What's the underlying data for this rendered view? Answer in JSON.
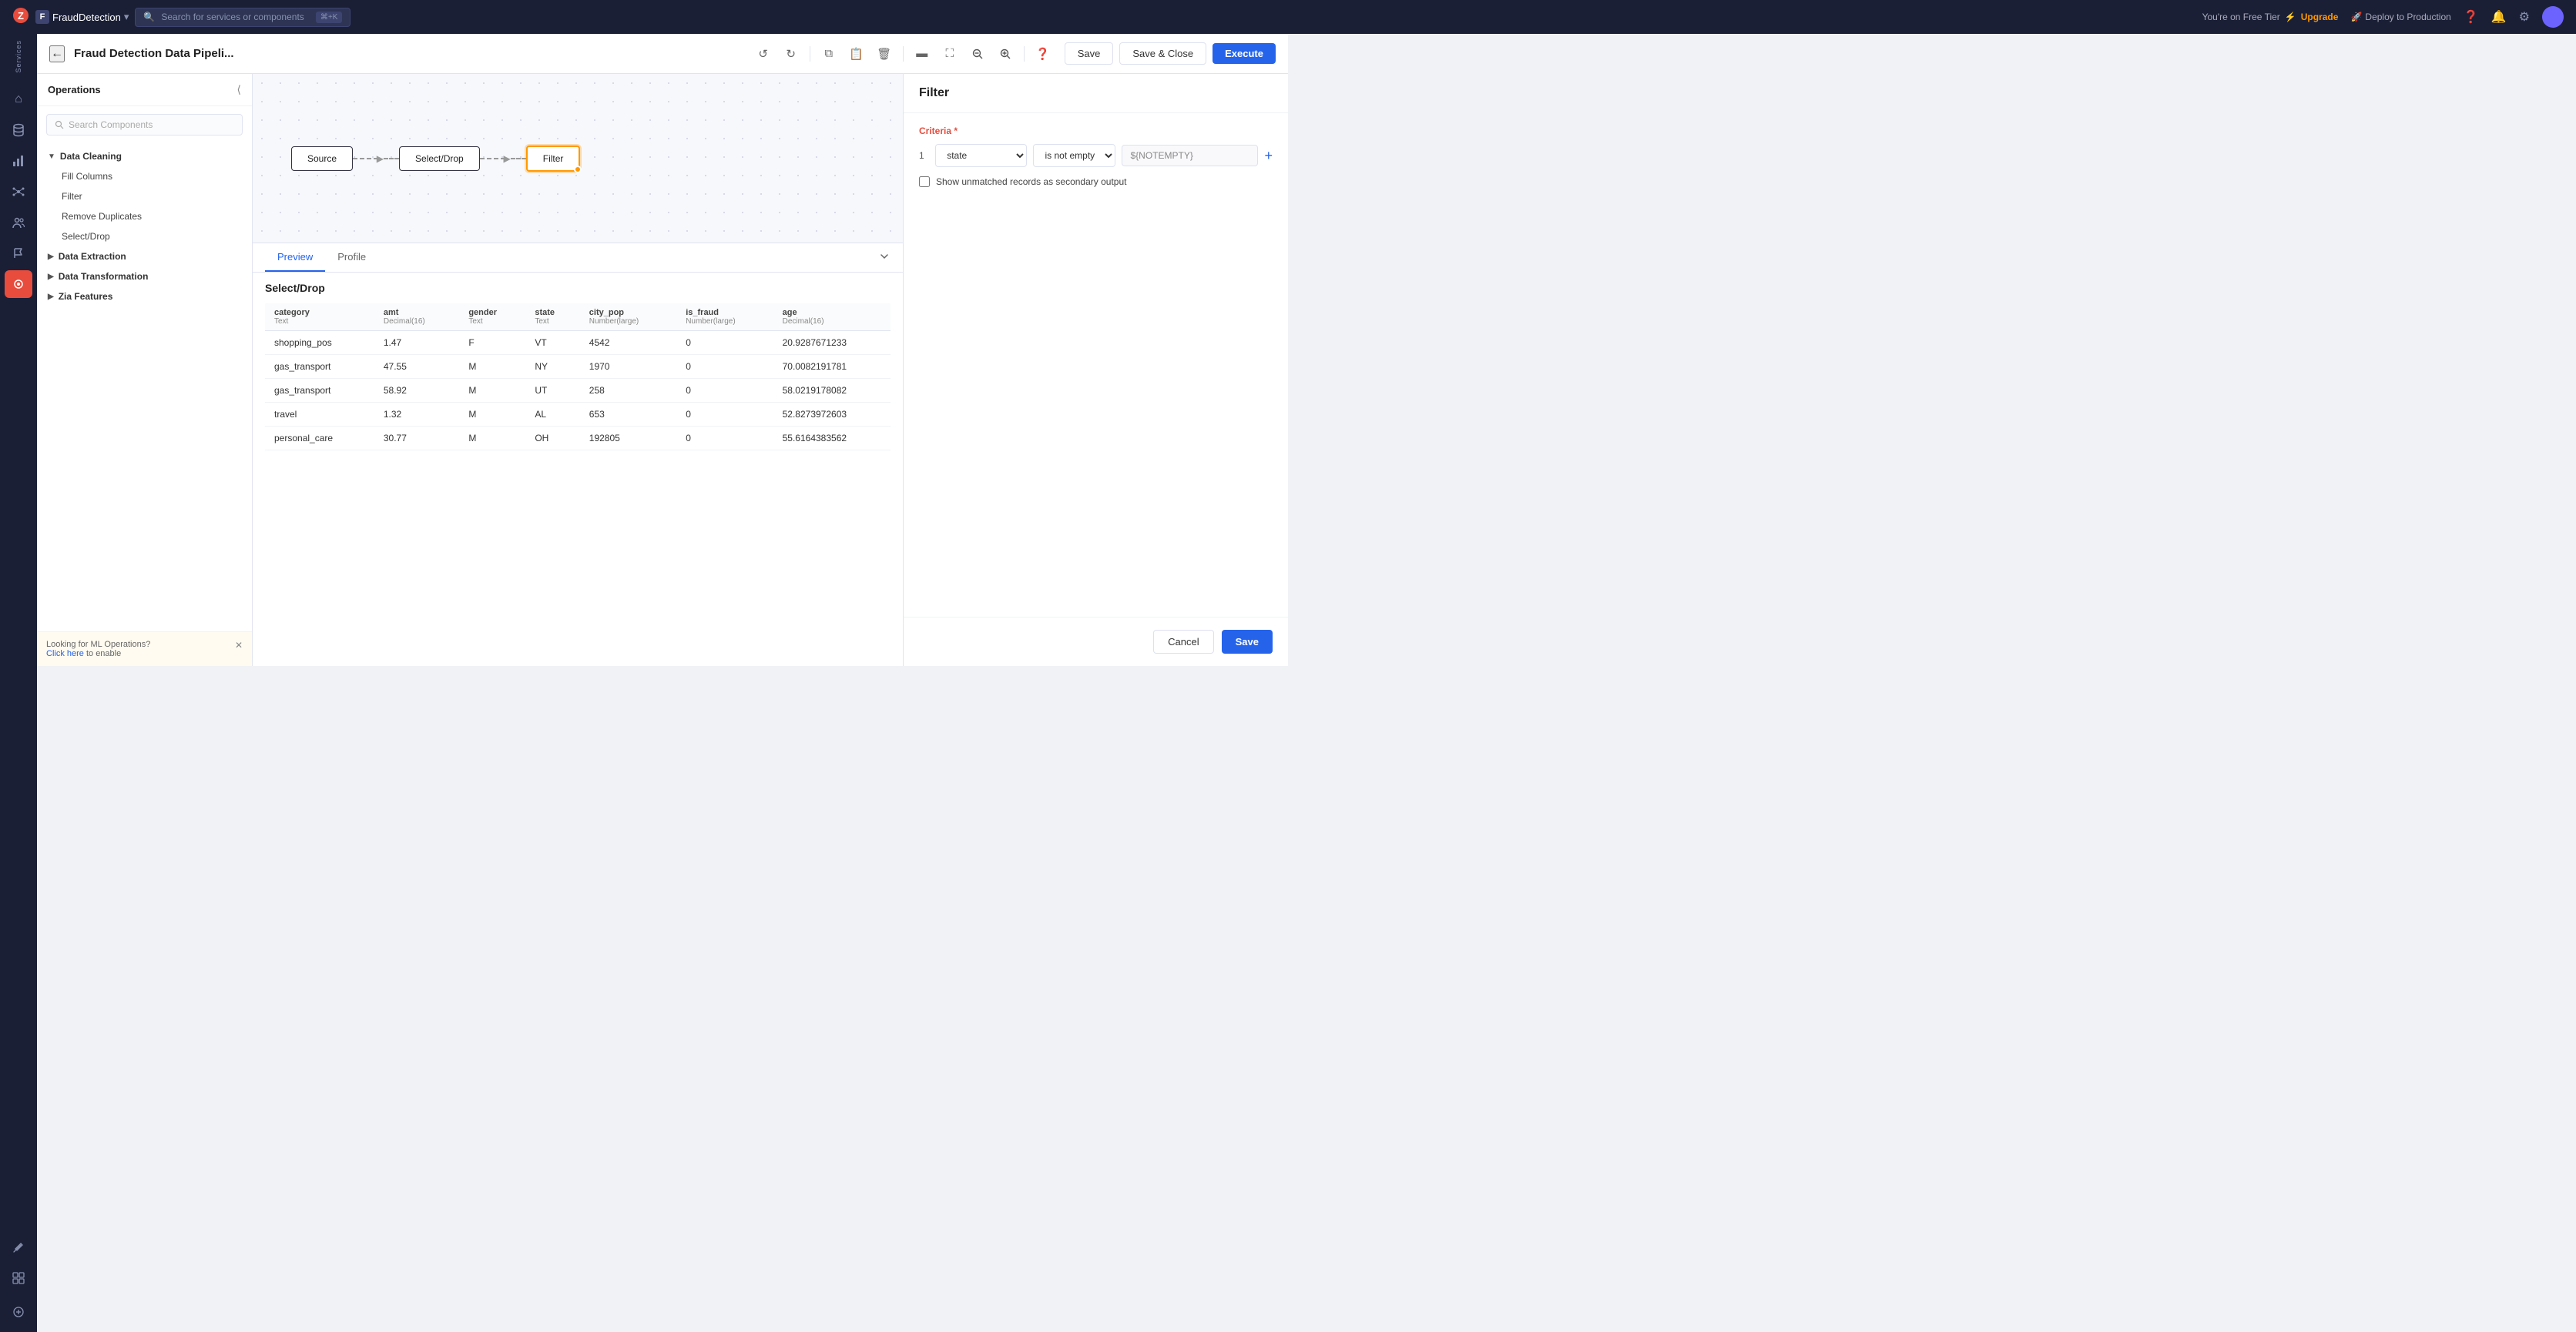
{
  "topNav": {
    "logo": "Z",
    "projectName": "FraudDetection",
    "searchPlaceholder": "Search for services or components",
    "searchShortcut": "⌘+K",
    "tierText": "You're on Free Tier",
    "upgradeLabel": "Upgrade",
    "deployLabel": "Deploy to Production"
  },
  "sidebar": {
    "servicesLabel": "Services",
    "items": [
      {
        "name": "home-icon",
        "icon": "⌂",
        "active": false
      },
      {
        "name": "database-icon",
        "icon": "🗄",
        "active": false
      },
      {
        "name": "chart-icon",
        "icon": "📊",
        "active": false
      },
      {
        "name": "network-icon",
        "icon": "⛙",
        "active": false
      },
      {
        "name": "people-icon",
        "icon": "👥",
        "active": false
      },
      {
        "name": "flag-icon",
        "icon": "⚑",
        "active": false
      },
      {
        "name": "pipeline-icon",
        "icon": "◎",
        "active": true
      },
      {
        "name": "settings-icon",
        "icon": "⚙",
        "active": false
      },
      {
        "name": "brush-icon",
        "icon": "✏",
        "active": false
      },
      {
        "name": "puzzle-icon",
        "icon": "⊞",
        "active": false
      }
    ]
  },
  "pipelineHeader": {
    "title": "Fraud Detection Data Pipeli...",
    "saveLabel": "Save",
    "saveCloseLabel": "Save & Close",
    "executeLabel": "Execute"
  },
  "operations": {
    "title": "Operations",
    "searchPlaceholder": "Search Components",
    "categories": [
      {
        "name": "Data Cleaning",
        "expanded": true,
        "items": [
          "Fill Columns",
          "Filter",
          "Remove Duplicates",
          "Select/Drop"
        ]
      },
      {
        "name": "Data Extraction",
        "expanded": false,
        "items": []
      },
      {
        "name": "Data Transformation",
        "expanded": false,
        "items": []
      },
      {
        "name": "Zia Features",
        "expanded": false,
        "items": []
      }
    ],
    "footer": {
      "text": "Looking for ML Operations?",
      "linkText": "Click here",
      "linkSuffix": " to enable"
    }
  },
  "pipeline": {
    "nodes": [
      {
        "label": "Source",
        "active": false
      },
      {
        "label": "Select/Drop",
        "active": false
      },
      {
        "label": "Filter",
        "active": true
      }
    ]
  },
  "filter": {
    "title": "Filter",
    "criteriaLabel": "Criteria",
    "required": true,
    "row": {
      "number": "1",
      "field": "state",
      "condition": "is not empty",
      "value": "${NOTEMPTY}"
    },
    "checkboxLabel": "Show unmatched records as secondary output",
    "cancelLabel": "Cancel",
    "saveLabel": "Save"
  },
  "preview": {
    "tabs": [
      {
        "label": "Preview",
        "active": true
      },
      {
        "label": "Profile",
        "active": false
      }
    ],
    "title": "Select/Drop",
    "columns": [
      {
        "name": "category",
        "type": "Text"
      },
      {
        "name": "amt",
        "type": "Decimal(16)"
      },
      {
        "name": "gender",
        "type": "Text"
      },
      {
        "name": "state",
        "type": "Text"
      },
      {
        "name": "city_pop",
        "type": "Number(large)"
      },
      {
        "name": "is_fraud",
        "type": "Number(large)"
      },
      {
        "name": "age",
        "type": "Decimal(16)"
      }
    ],
    "rows": [
      [
        "shopping_pos",
        "1.47",
        "F",
        "VT",
        "4542",
        "0",
        "20.9287671233"
      ],
      [
        "gas_transport",
        "47.55",
        "M",
        "NY",
        "1970",
        "0",
        "70.0082191781"
      ],
      [
        "gas_transport",
        "58.92",
        "M",
        "UT",
        "258",
        "0",
        "58.0219178082"
      ],
      [
        "travel",
        "1.32",
        "M",
        "AL",
        "653",
        "0",
        "52.8273972603"
      ],
      [
        "personal_care",
        "30.77",
        "M",
        "OH",
        "192805",
        "0",
        "55.6164383562"
      ]
    ]
  }
}
